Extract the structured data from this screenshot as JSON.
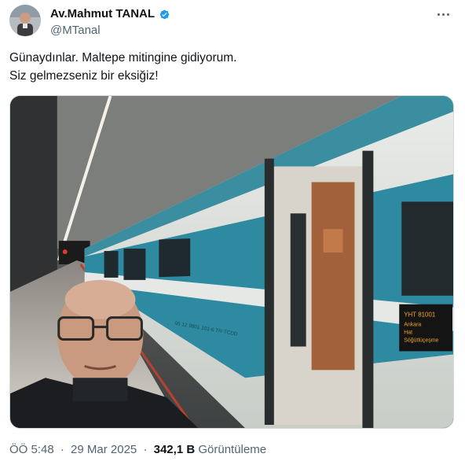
{
  "author": {
    "display_name": "Av.Mahmut TANAL",
    "handle": "@MTanal",
    "verified": true
  },
  "tweet": {
    "lines": [
      "Günaydınlar. Maltepe mitingine gidiyorum.",
      "Siz gelmezseniz bir eksiğiz!"
    ]
  },
  "photo": {
    "train_number_text": "YHT 81001",
    "train_route_line1": "Ankara",
    "train_route_line2": "Hat",
    "train_route_line3": "Söğütlüçeşme",
    "car_label": "05 12 9801 101-6 TR-TCDD"
  },
  "meta": {
    "time": "ÖÖ 5:48",
    "date": "29 Mar 2025",
    "separator": "·",
    "views_count": "342,1 B",
    "views_label": "Görüntüleme"
  },
  "colors": {
    "text_primary": "#0f1419",
    "text_secondary": "#536471",
    "verified_blue": "#1d9bf0",
    "train_teal": "#2d8aa0"
  },
  "icons": {
    "verified": "verified-badge-icon",
    "more": "more-horizontal-icon"
  }
}
